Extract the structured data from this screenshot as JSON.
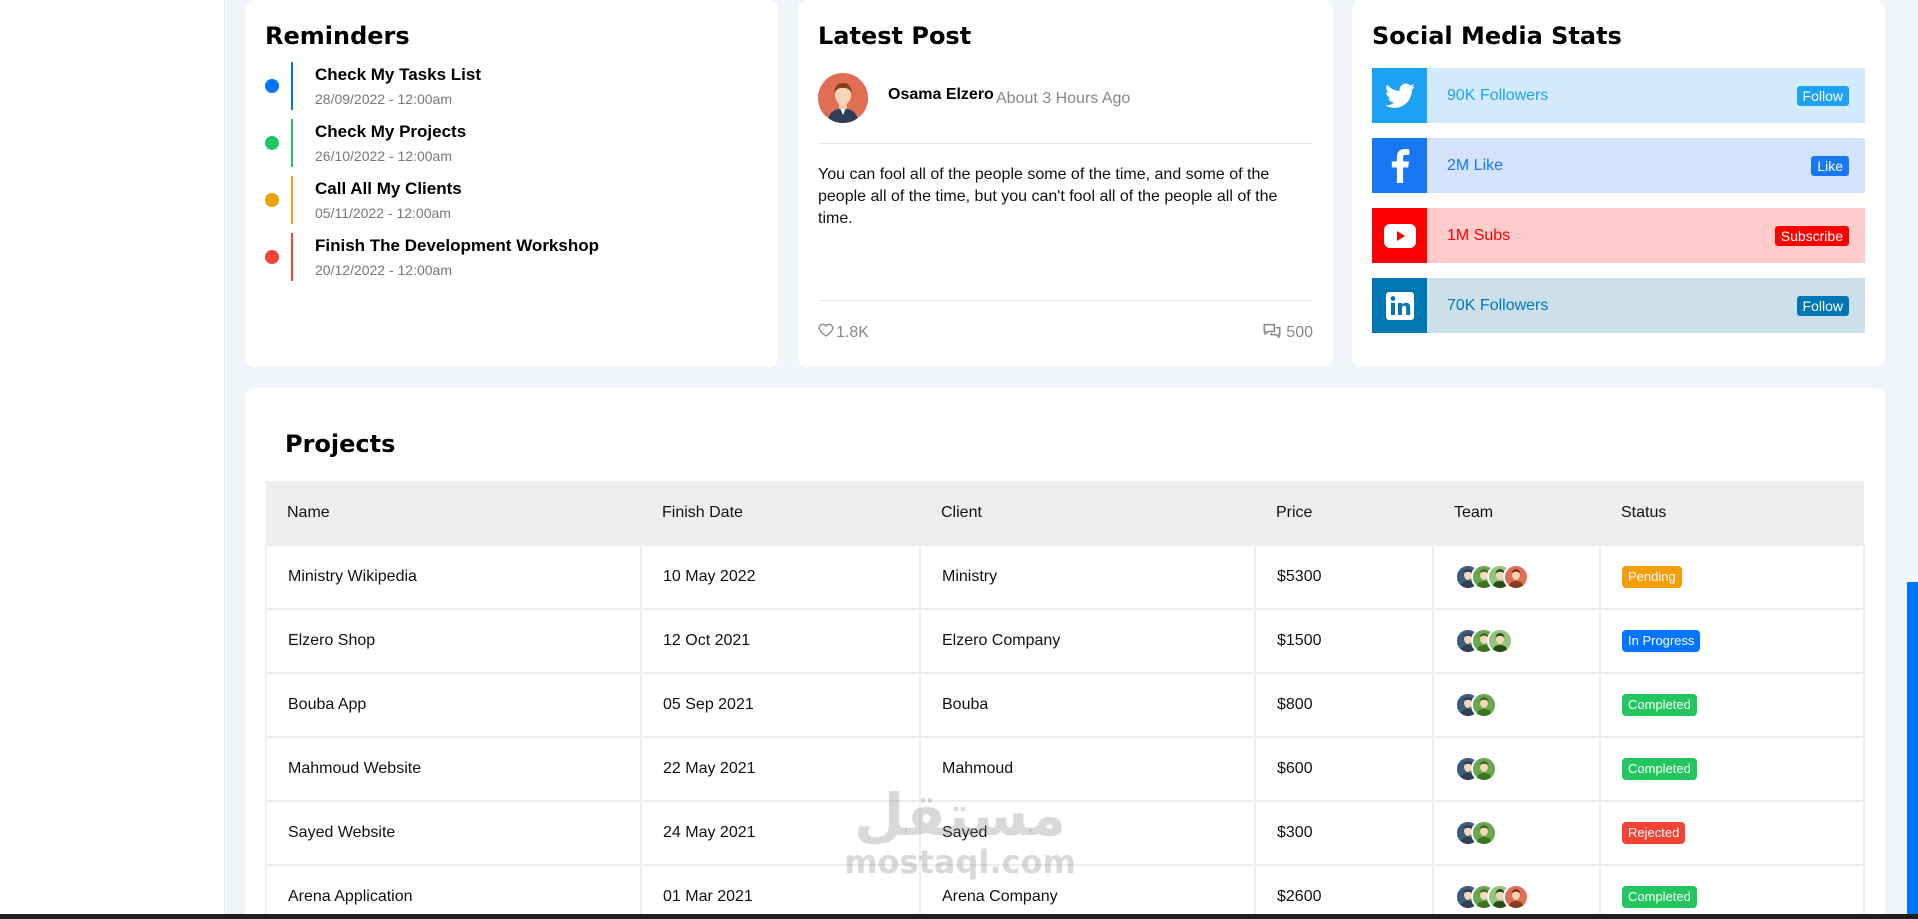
{
  "reminders": {
    "title": "Reminders",
    "items": [
      {
        "title": "Check My Tasks List",
        "date": "28/09/2022 - 12:00am",
        "color": "#0075ff"
      },
      {
        "title": "Check My Projects",
        "date": "26/10/2022 - 12:00am",
        "color": "#22c55e"
      },
      {
        "title": "Call All My Clients",
        "date": "05/11/2022 - 12:00am",
        "color": "#f59e0b"
      },
      {
        "title": "Finish The Development Workshop",
        "date": "20/12/2022 - 12:00am",
        "color": "#f44336"
      }
    ]
  },
  "latest_post": {
    "title": "Latest Post",
    "author": "Osama Elzero",
    "time": "About 3 Hours Ago",
    "body": "You can fool all of the people some of the time, and some of the people all of the time, but you can't fool all of the people all of the time.",
    "likes": "1.8K",
    "comments": "500"
  },
  "social": {
    "title": "Social Media Stats",
    "items": [
      {
        "network": "twitter",
        "icon": "twitter-icon",
        "text": "90K Followers",
        "button": "Follow",
        "color": "#1da1f2",
        "bg": "#d2eafb"
      },
      {
        "network": "facebook",
        "icon": "facebook-icon",
        "text": "2M Like",
        "button": "Like",
        "color": "#1877f2",
        "bg": "#d2e3fb"
      },
      {
        "network": "youtube",
        "icon": "youtube-icon",
        "text": "1M Subs",
        "button": "Subscribe",
        "color": "#ff0000",
        "bg": "#ffcccc"
      },
      {
        "network": "linkedin",
        "icon": "linkedin-icon",
        "text": "70K Followers",
        "button": "Follow",
        "color": "#0077b5",
        "bg": "#cce0ec"
      }
    ]
  },
  "projects": {
    "title": "Projects",
    "columns": [
      "Name",
      "Finish Date",
      "Client",
      "Price",
      "Team",
      "Status"
    ],
    "rows": [
      {
        "name": "Ministry Wikipedia",
        "date": "10 May 2022",
        "client": "Ministry",
        "price": "$5300",
        "team": 4,
        "status": "Pending",
        "status_color": "#f59e0b"
      },
      {
        "name": "Elzero Shop",
        "date": "12 Oct 2021",
        "client": "Elzero Company",
        "price": "$1500",
        "team": 3,
        "status": "In Progress",
        "status_color": "#0075ff"
      },
      {
        "name": "Bouba App",
        "date": "05 Sep 2021",
        "client": "Bouba",
        "price": "$800",
        "team": 2,
        "status": "Completed",
        "status_color": "#22c55e"
      },
      {
        "name": "Mahmoud Website",
        "date": "22 May 2021",
        "client": "Mahmoud",
        "price": "$600",
        "team": 2,
        "status": "Completed",
        "status_color": "#22c55e"
      },
      {
        "name": "Sayed Website",
        "date": "24 May 2021",
        "client": "Sayed",
        "price": "$300",
        "team": 2,
        "status": "Rejected",
        "status_color": "#f44336"
      },
      {
        "name": "Arena Application",
        "date": "01 Mar 2021",
        "client": "Arena Company",
        "price": "$2600",
        "team": 4,
        "status": "Completed",
        "status_color": "#22c55e"
      }
    ]
  },
  "watermark": {
    "logo": "مستقل",
    "domain": "mostaql.com"
  }
}
